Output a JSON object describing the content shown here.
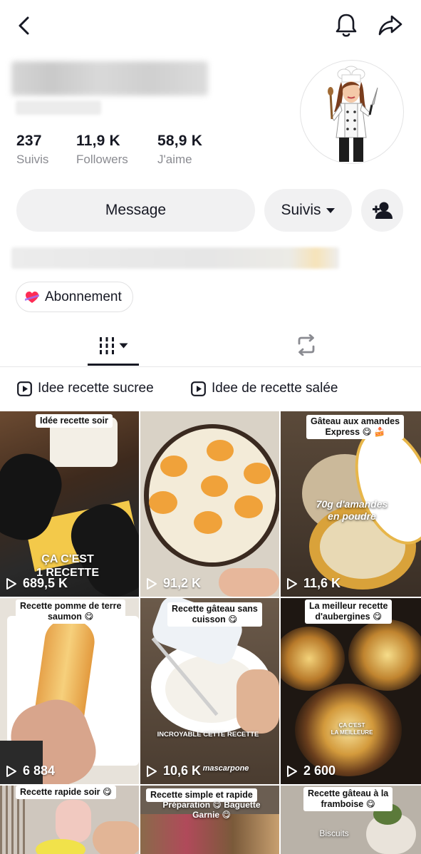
{
  "profile": {
    "stats": [
      {
        "value": "237",
        "label": "Suivis"
      },
      {
        "value": "11,9 K",
        "label": "Followers"
      },
      {
        "value": "58,9 K",
        "label": "J'aime"
      }
    ]
  },
  "actions": {
    "message_label": "Message",
    "suivis_label": "Suivis"
  },
  "subscription": {
    "label": "Abonnement"
  },
  "playlists": [
    {
      "label": "Idee recette sucree"
    },
    {
      "label": "Idee de recette salée"
    }
  ],
  "videos": [
    {
      "caption": "Idée recette soir",
      "views": "689,5 K",
      "overlay": "ÇA C'EST\n1 RECETTE"
    },
    {
      "caption": "",
      "views": "91,2 K",
      "overlay": ""
    },
    {
      "caption": "Gâteau aux amandes\nExpress 😋 🍰",
      "views": "11,6 K",
      "overlay": "70g d'amandes\nen poudre"
    },
    {
      "caption": "Recette pomme de terre\nsaumon 😋",
      "views": "6 884",
      "overlay": ""
    },
    {
      "caption": "Recette gâteau sans\ncuisson 😋",
      "views": "10,6 K",
      "overlay": "INCROYABLE CETTE RECETTE",
      "overlay2": "mascarpone"
    },
    {
      "caption": "La meilleur recette\nd'aubergines 😋",
      "views": "2 600",
      "overlay": "ÇA C'EST\nLA MEILLEURE"
    },
    {
      "caption": "Recette rapide soir 😋",
      "views": "",
      "overlay": ""
    },
    {
      "caption": "Recette simple et rapide",
      "views": "",
      "overlay": "Préparation 😋 Baguette\nGarnie 😋"
    },
    {
      "caption": "Recette gâteau à la\nframboise 😋",
      "views": "",
      "overlay": "Biscuits"
    }
  ],
  "icons": {
    "back": "chevron-left-icon",
    "bell": "bell-icon",
    "share": "share-arrow-icon",
    "dropdown": "caret-down-icon",
    "add_user": "add-user-icon",
    "subscription": "heart-ribbon-icon",
    "videos_tab": "grid-bars-icon",
    "reposts_tab": "repost-icon",
    "playlist": "play-square-icon",
    "views": "play-outline-icon"
  },
  "colors": {
    "text": "#161823",
    "secondary_text": "#8a8b91",
    "button_bg": "#f1f1f2",
    "subscription_accent": "#fe2c55"
  }
}
